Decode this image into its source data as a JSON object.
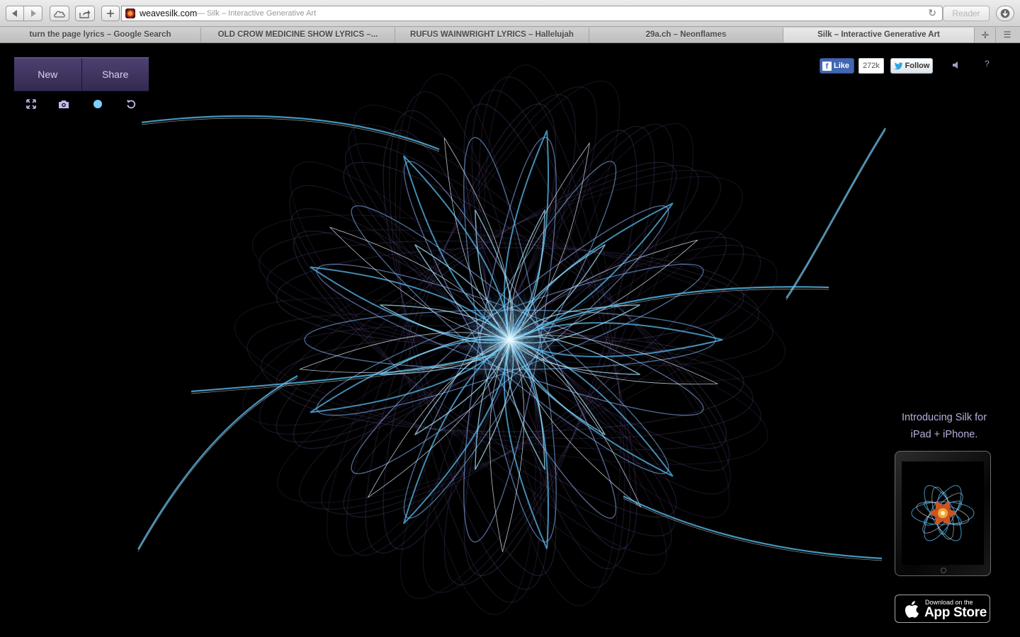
{
  "browser": {
    "url_domain": "weavesilk.com",
    "url_title": "— Silk – Interactive Generative Art",
    "reader_label": "Reader",
    "tabs": [
      {
        "label": "turn the page lyrics – Google Search"
      },
      {
        "label": "OLD CROW MEDICINE SHOW LYRICS –..."
      },
      {
        "label": "RUFUS WAINWRIGHT LYRICS – Hallelujah"
      },
      {
        "label": "29a.ch – Neonflames"
      },
      {
        "label": "Silk – Interactive Generative Art"
      }
    ],
    "active_tab_index": 4
  },
  "silk": {
    "new_label": "New",
    "share_label": "Share",
    "tools": [
      "fullscreen-icon",
      "camera-icon",
      "color-dot-icon",
      "undo-icon"
    ],
    "brush_color": "#7ed0ff",
    "social": {
      "like_label": "Like",
      "like_count": "272k",
      "follow_label": "Follow"
    },
    "help_label": "?",
    "promo": {
      "line1": "Introducing Silk for",
      "line2": "iPad + iPhone."
    },
    "app_store": {
      "small_text": "Download on the",
      "big_text": "App Store"
    },
    "accent_purple": "#8a74c9",
    "accent_cyan": "#5ec8ff"
  }
}
